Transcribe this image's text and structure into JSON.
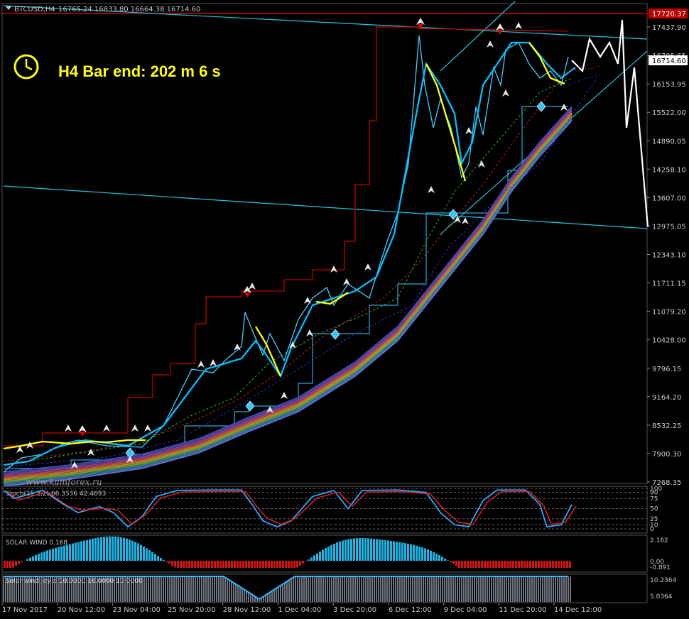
{
  "header": {
    "symbol": "BTCUSD,H4",
    "ohlc": "16765.24 16833.80 16664.38 16714.60"
  },
  "timer_text": "H4 Bar end: 202 m 6 s",
  "watermark": "www.kamforex.ru",
  "price_axis": {
    "labels": [
      "17437.90",
      "16795.65",
      "16153.95",
      "15522.00",
      "14890.05",
      "14258.10",
      "13607.00",
      "12975.05",
      "12343.10",
      "11711.15",
      "11079.20",
      "10428.00",
      "9796.15",
      "9164.20",
      "8532.25",
      "7900.30",
      "7268.35"
    ],
    "marker_high": "17720.37",
    "marker_current": "16714.60"
  },
  "time_axis": {
    "labels": [
      "17 Nov 2017",
      "20 Nov 12:00",
      "23 Nov 04:00",
      "25 Nov 20:00",
      "28 Nov 12:00",
      "1 Dec 04:00",
      "3 Dec 20:00",
      "6 Dec 12:00",
      "9 Dec 04:00",
      "11 Dec 20:00",
      "14 Dec 12:00"
    ]
  },
  "stoch_panel": {
    "title": "Stoch(15,2,2) 66.3536 42.4693",
    "levels": [
      "100",
      "75",
      "50",
      "25",
      "0"
    ],
    "extra_levels": [
      "90",
      "10"
    ]
  },
  "solar_panel": {
    "title": "SOLAR WIND 0.168",
    "scale": [
      "2.162",
      "0.00",
      "-0.891"
    ]
  },
  "joy_panel": {
    "title": "Solar wind joy :: 10.0000 10.0000 10.0000",
    "scale": [
      "10.2364",
      "5.0364"
    ]
  },
  "colors": {
    "background": "#000000",
    "price_line": "#00bfff",
    "fast_line": "#3fd0ff",
    "yellow_line": "#ffff00",
    "red_envelope": "#c00000",
    "trend_channel": "#1ec8dc",
    "forecast": "#ffffff",
    "hist_pos": "#19b5e6",
    "hist_neg": "#d21414",
    "high_box": "#c00000"
  },
  "chart_data": {
    "type": "line",
    "title": "BTCUSD,H4",
    "ylim": [
      7268.35,
      17720.37
    ],
    "x": [
      "17 Nov 2017",
      "20 Nov 12:00",
      "23 Nov 04:00",
      "25 Nov 20:00",
      "28 Nov 12:00",
      "1 Dec 04:00",
      "3 Dec 20:00",
      "6 Dec 12:00",
      "9 Dec 04:00",
      "11 Dec 20:00",
      "14 Dec 12:00"
    ],
    "series": [
      {
        "values": [
          7800,
          8180,
          8100,
          8520,
          9380,
          10350,
          11500,
          16150,
          13800,
          16900,
          16714.6
        ]
      }
    ],
    "stochastic": {
      "main": 66.3536,
      "signal": 42.4693
    },
    "solar_wind_value": 0.168,
    "solar_wind_joy": [
      10.0,
      10.0,
      10.0
    ]
  }
}
